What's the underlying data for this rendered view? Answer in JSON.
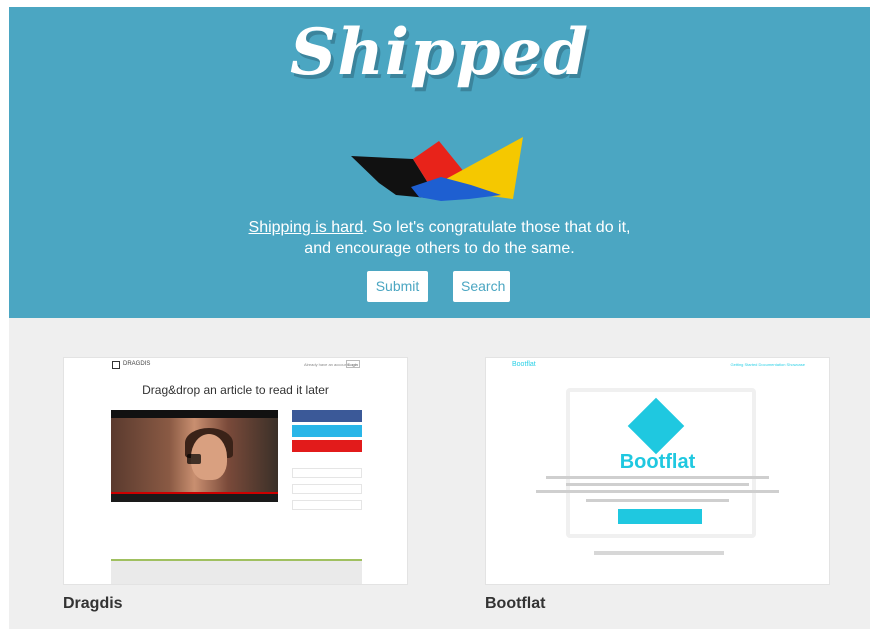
{
  "colors": {
    "hero_bg": "#4ba6c2",
    "gallery_bg": "#efefef",
    "button_text": "#4ba6c2",
    "boat_black": "#111111",
    "boat_red": "#e8231a",
    "boat_yellow": "#f5c800",
    "boat_blue": "#1e5fd1"
  },
  "header": {
    "logo_text": "Shipped",
    "logo_icon": "paper-boat-icon"
  },
  "tagline": {
    "link_text": "Shipping is hard",
    "line1_rest": ". So let's congratulate those that do it,",
    "line2": "and encourage others to do the same."
  },
  "actions": {
    "submit_label": "Submit",
    "search_label": "Search"
  },
  "gallery": {
    "items": [
      {
        "title": "Dragdis",
        "thumb": {
          "brand": "DRAGDIS",
          "signin": "Already have an account?",
          "login": "Login",
          "headline": "Drag&drop an article to read it later"
        }
      },
      {
        "title": "Bootflat",
        "thumb": {
          "brand": "Bootflat",
          "nav": "Getting Started   Documentation   Showcase",
          "title": "Bootflat"
        }
      }
    ]
  }
}
